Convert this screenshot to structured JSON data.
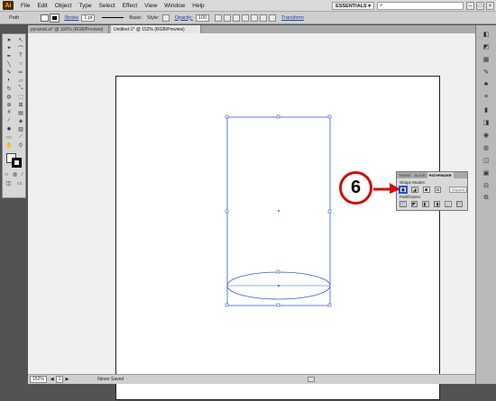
{
  "app": {
    "logo": "Ai"
  },
  "menu": [
    "File",
    "Edit",
    "Object",
    "Type",
    "Select",
    "Effect",
    "View",
    "Window",
    "Help"
  ],
  "workspace": {
    "label": "ESSENTIALS",
    "search_placeholder": ""
  },
  "control_bar": {
    "selection_label": "Path",
    "stroke_label": "Stroke",
    "stroke_weight": "1 pt",
    "brush_label": "Basic",
    "style_label": "Style:",
    "opacity_label": "Opacity:",
    "opacity_value": "100",
    "transform_label": "Transform"
  },
  "tabs": [
    {
      "label": "pyramid.ai* @ 100% (RGB/Preview)",
      "active": false
    },
    {
      "label": "Untitled-1* @ 152% (RGB/Preview)",
      "active": true
    }
  ],
  "pathfinder": {
    "tabs": [
      "TRANS",
      "ALIGN",
      "PATHFINDER"
    ],
    "shape_modes_label": "Shape Modes:",
    "pathfinders_label": "Pathfinders:",
    "expand_label": "Expand"
  },
  "callout": {
    "number": "6"
  },
  "status_bar": {
    "zoom": "152%",
    "artboard": "1",
    "status": "Never Saved"
  },
  "colors": {
    "selection_blue": "#3a5bd6",
    "callout_red": "#d40b0b"
  }
}
